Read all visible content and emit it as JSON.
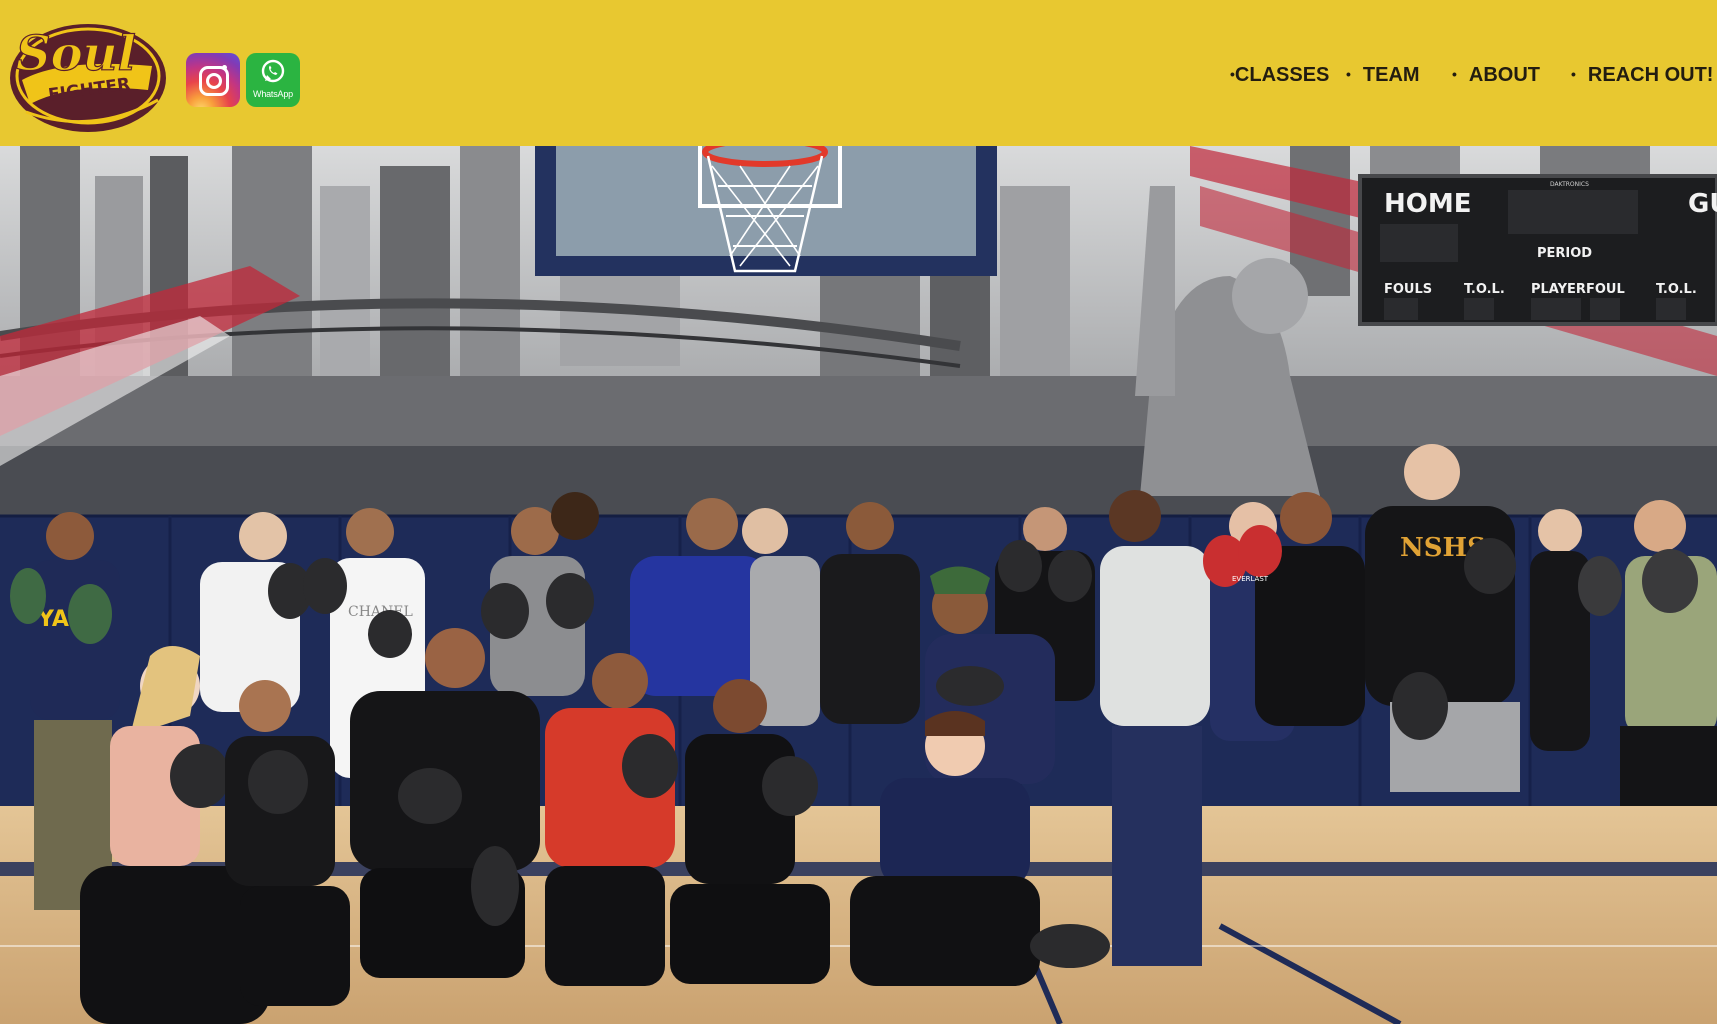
{
  "header": {
    "logo": {
      "text_top": "Soul",
      "text_bottom": "FIGHTER"
    },
    "social": {
      "instagram_icon": "instagram-icon",
      "whatsapp_icon": "whatsapp-icon",
      "whatsapp_label": "WhatsApp"
    },
    "nav": [
      {
        "bullet": "•",
        "label": "CLASSES"
      },
      {
        "bullet": "•",
        "label": "TEAM"
      },
      {
        "bullet": "•",
        "label": "ABOUT"
      },
      {
        "bullet": "•",
        "label": "REACH OUT!"
      }
    ]
  },
  "hero": {
    "scoreboard": {
      "home": "HOME",
      "guest": "GU",
      "brand": "DAKTRONICS",
      "period": "PERIOD",
      "fouls": "FOULS",
      "tol": "T.O.L.",
      "player": "PLAYER",
      "foul": "FOUL",
      "tol2": "T.O.L."
    },
    "shirts": {
      "yale": "YALE",
      "chanel": "CHANEL",
      "nshs": "NSHS",
      "everlast": "EVERLAST"
    }
  },
  "colors": {
    "header_bg": "#e8c830",
    "logo_maroon": "#5a1f2a",
    "logo_gold": "#f0c418",
    "nav_text": "#231d10",
    "wall_navy": "#1e2b58",
    "floor_wood": "#d9b88a"
  }
}
